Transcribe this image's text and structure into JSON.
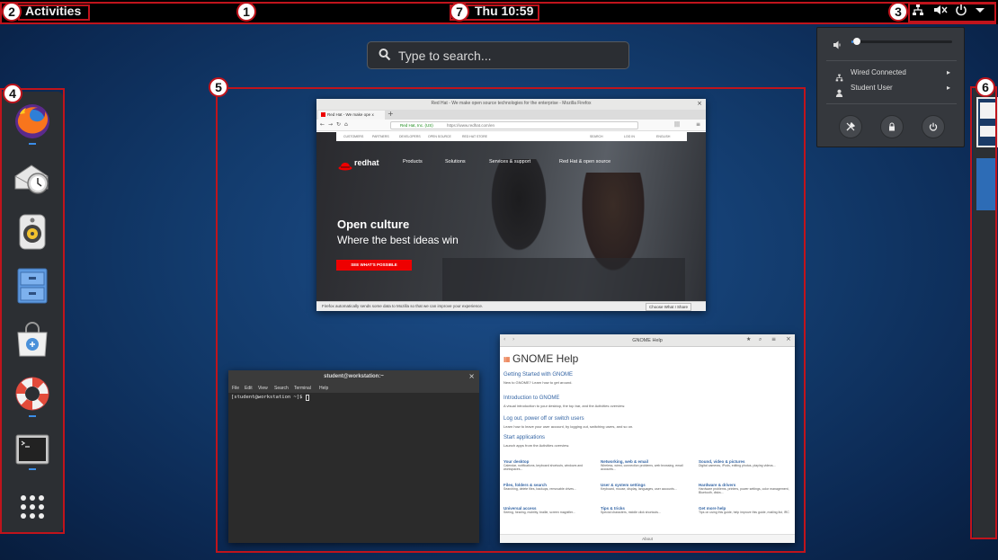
{
  "topbar": {
    "activities_label": "Activities",
    "clock": "Thu 10:59",
    "icons": [
      "network-wired-icon",
      "audio-muted-icon",
      "power-icon",
      "chevron-down-icon"
    ]
  },
  "annotations": [
    "1",
    "2",
    "3",
    "4",
    "5",
    "6",
    "7"
  ],
  "search": {
    "placeholder": "Type to search..."
  },
  "dash": {
    "apps": [
      "firefox",
      "evolution",
      "rhythmbox",
      "files",
      "software",
      "help",
      "terminal",
      "show-applications"
    ]
  },
  "system_menu": {
    "volume_level": 0.02,
    "network_label": "Wired Connected",
    "user_label": "Student User",
    "buttons": [
      "settings-icon",
      "lock-icon",
      "power-icon"
    ]
  },
  "firefox_window": {
    "title": "Red Hat - We make open source technologies for the enterprise - Mozilla Firefox",
    "tab_label": "Red Hat - We make ope x",
    "url_company": "Red Hat, Inc. (US)",
    "url": "https://www.redhat.com/en",
    "nav_small": [
      "CUSTOMERS",
      "PARTNERS",
      "DEVELOPERS",
      "OPEN SOURCE",
      "RED HAT STORE"
    ],
    "nav_right": [
      "SEARCH",
      "LOG IN",
      "ENGLISH"
    ],
    "brand": "redhat",
    "nav_main": [
      "Products",
      "Solutions",
      "Services & support",
      "Red Hat & open source"
    ],
    "headline_1": "Open culture",
    "headline_2": "Where the best ideas win",
    "cta": "SEE WHAT'S POSSIBLE",
    "notice": "Firefox automatically sends some data to Mozilla so that we can improve your experience.",
    "notice_button": "Choose What I Share"
  },
  "terminal_window": {
    "title": "student@workstation:~",
    "menu": [
      "File",
      "Edit",
      "View",
      "Search",
      "Terminal",
      "Help"
    ],
    "prompt": "[student@workstation ~]$ "
  },
  "help_window": {
    "title": "GNOME Help",
    "heading": "GNOME Help",
    "sections": [
      {
        "title": "Getting Started with GNOME",
        "desc": "New to GNOME? Learn how to get around."
      },
      {
        "title": "Introduction to GNOME",
        "desc": "A visual introduction to your desktop, the top bar, and the Activities overview."
      },
      {
        "title": "Log out, power off or switch users",
        "desc": "Learn how to leave your user account, by logging out, switching users, and so on."
      },
      {
        "title": "Start applications",
        "desc": "Launch apps from the Activities overview."
      }
    ],
    "topics": [
      {
        "title": "Your desktop",
        "desc": "Calendar, notifications, keyboard shortcuts, windows and workspaces..."
      },
      {
        "title": "Networking, web & email",
        "desc": "Wireless, wired, connection problems, web browsing, email accounts..."
      },
      {
        "title": "Sound, video & pictures",
        "desc": "Digital cameras, iPods, editing photos, playing videos..."
      },
      {
        "title": "Files, folders & search",
        "desc": "Searching, delete files, backups, removable drives..."
      },
      {
        "title": "User & system settings",
        "desc": "Keyboard, mouse, display, languages, user accounts..."
      },
      {
        "title": "Hardware & drivers",
        "desc": "Hardware problems, printers, power settings, color management, Bluetooth, disks..."
      },
      {
        "title": "Universal access",
        "desc": "Seeing, hearing, mobility, braille, screen magnifier..."
      },
      {
        "title": "Tips & tricks",
        "desc": "Special characters, middle click shortcuts..."
      },
      {
        "title": "Get more help",
        "desc": "Tips on using this guide, help improve this guide, mailing list, IRC"
      }
    ],
    "footer": "About"
  },
  "colors": {
    "annotation_red": "#c0141c",
    "accent_blue": "#3b8ee8",
    "redhat_red": "#ee0000"
  }
}
